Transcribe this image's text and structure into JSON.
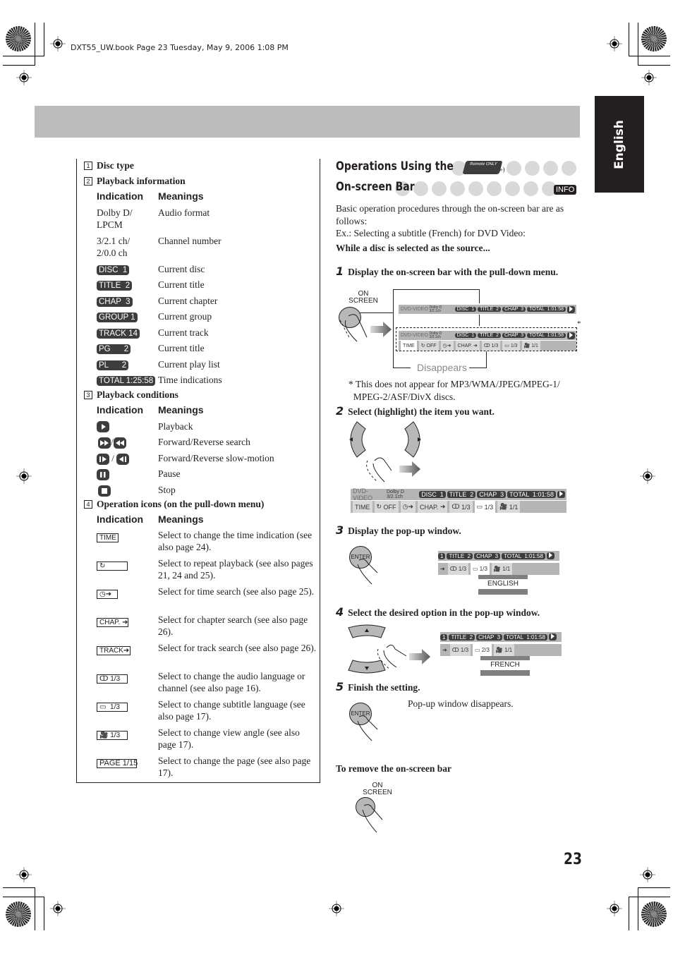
{
  "print_header": {
    "slug": "DXT55_UW.book  Page 23  Tuesday, May 9, 2006  1:08 PM"
  },
  "language_tab": "English",
  "page_number": "23",
  "left_panel": {
    "sections": [
      {
        "num": "1",
        "title": "Disc type"
      },
      {
        "num": "2",
        "title": "Playback information"
      },
      {
        "num": "3",
        "title": "Playback conditions"
      },
      {
        "num": "4",
        "title": "Operation icons (on the pull-down menu)"
      }
    ],
    "col_indication": "Indication",
    "col_meanings": "Meanings",
    "playback_info": [
      {
        "indication": "Dolby D/\nLPCM",
        "type": "text",
        "meaning": "Audio format"
      },
      {
        "indication": "3/2.1 ch/\n2/0.0 ch",
        "type": "text",
        "meaning": "Channel number"
      },
      {
        "indication": "DISC  1",
        "type": "pill",
        "meaning": "Current disc"
      },
      {
        "indication": "TITLE  2",
        "type": "pill",
        "meaning": "Current title"
      },
      {
        "indication": "CHAP  3",
        "type": "pill",
        "meaning": "Current chapter"
      },
      {
        "indication": "GROUP 1",
        "type": "pill",
        "meaning": "Current group"
      },
      {
        "indication": "TRACK 14",
        "type": "pill",
        "meaning": "Current track"
      },
      {
        "indication": "PG      2",
        "type": "pill",
        "meaning": "Current title"
      },
      {
        "indication": "PL      2",
        "type": "pill",
        "meaning": "Current play list"
      },
      {
        "indication": "TOTAL 1:25:58",
        "type": "pill",
        "meaning": "Time indications"
      }
    ],
    "playback_conditions": [
      {
        "icon": "play-icon",
        "meaning": "Playback"
      },
      {
        "icon": "forward-reverse-search-icon",
        "meaning": "Forward/Reverse search"
      },
      {
        "icon": "forward-reverse-slow-icon",
        "meaning": "Forward/Reverse slow-motion"
      },
      {
        "icon": "pause-icon",
        "meaning": "Pause"
      },
      {
        "icon": "stop-icon",
        "meaning": "Stop"
      }
    ],
    "operation_icons": [
      {
        "indication": "TIME",
        "icon": "time-icon",
        "meaning": "Select to change the time indication (see also page 24)."
      },
      {
        "indication": "",
        "icon": "repeat-icon",
        "meaning": "Select to repeat playback (see also pages 21, 24 and 25)."
      },
      {
        "indication": "",
        "icon": "time-search-icon",
        "meaning": "Select for time search (see also page 25)."
      },
      {
        "indication": "CHAP.",
        "icon": "chapter-search-icon",
        "meaning": "Select for chapter search (see also page 26)."
      },
      {
        "indication": "TRACK",
        "icon": "track-search-icon",
        "meaning": "Select for track search (see also page 26)."
      },
      {
        "indication": "1/3",
        "icon": "audio-icon",
        "meaning": "Select to change the audio language or channel (see also page 16)."
      },
      {
        "indication": "1/3",
        "icon": "subtitle-icon",
        "meaning": "Select to change subtitle language (see also page 17)."
      },
      {
        "indication": "1/3",
        "icon": "angle-icon",
        "meaning": "Select to change view angle (see also page 17)."
      },
      {
        "indication": "PAGE 1/15",
        "icon": "page-icon",
        "meaning": "Select to change the page (see also page 17)."
      }
    ]
  },
  "right_panel": {
    "title_line1": "Operations Using the",
    "title_line2": "On-screen Bar",
    "remote_badge": "Remote ONLY",
    "info_badge": "INFO",
    "intro": "Basic operation procedures through the on-screen bar are as follows:",
    "example": "Ex.: Selecting a subtitle (French) for DVD Video:",
    "precondition": "While a disc is selected as the source...",
    "steps": [
      {
        "num": "1",
        "text": "Display the on-screen bar with the pull-down menu."
      },
      {
        "num": "2",
        "text": "Select (highlight) the item you want."
      },
      {
        "num": "3",
        "text": "Display the pop-up window."
      },
      {
        "num": "4",
        "text": "Select the desired option in the pop-up window."
      },
      {
        "num": "5",
        "text": "Finish the setting."
      }
    ],
    "on_screen_button": "ON\nSCREEN",
    "enter_button": "ENTER",
    "disappears_label": "Disappears",
    "footnote": "* This does not appear for MP3/WMA/JPEG/MPEG-1/\n  MPEG-2/ASF/DivX discs.",
    "asterisk": "*",
    "osd": {
      "disc_type": "DVD-VIDEO",
      "audio": "Dolby D",
      "channels": "3/2.1ch",
      "disc": "DISC  1",
      "title": "TITLE  2",
      "chap": "CHAP  3",
      "total": "TOTAL  1:01:58",
      "menu_time": "TIME",
      "menu_repeat": "OFF",
      "menu_chap": "CHAP.",
      "menu_audio": "1/3",
      "menu_subtitle": "1/3",
      "menu_angle": "1/1",
      "subtitle_after": "2/3",
      "popup_before": "ENGLISH",
      "popup_after": "FRENCH",
      "disc_short": "1"
    },
    "step5_result": "Pop-up window disappears.",
    "remove_heading": "To remove the on-screen bar"
  }
}
